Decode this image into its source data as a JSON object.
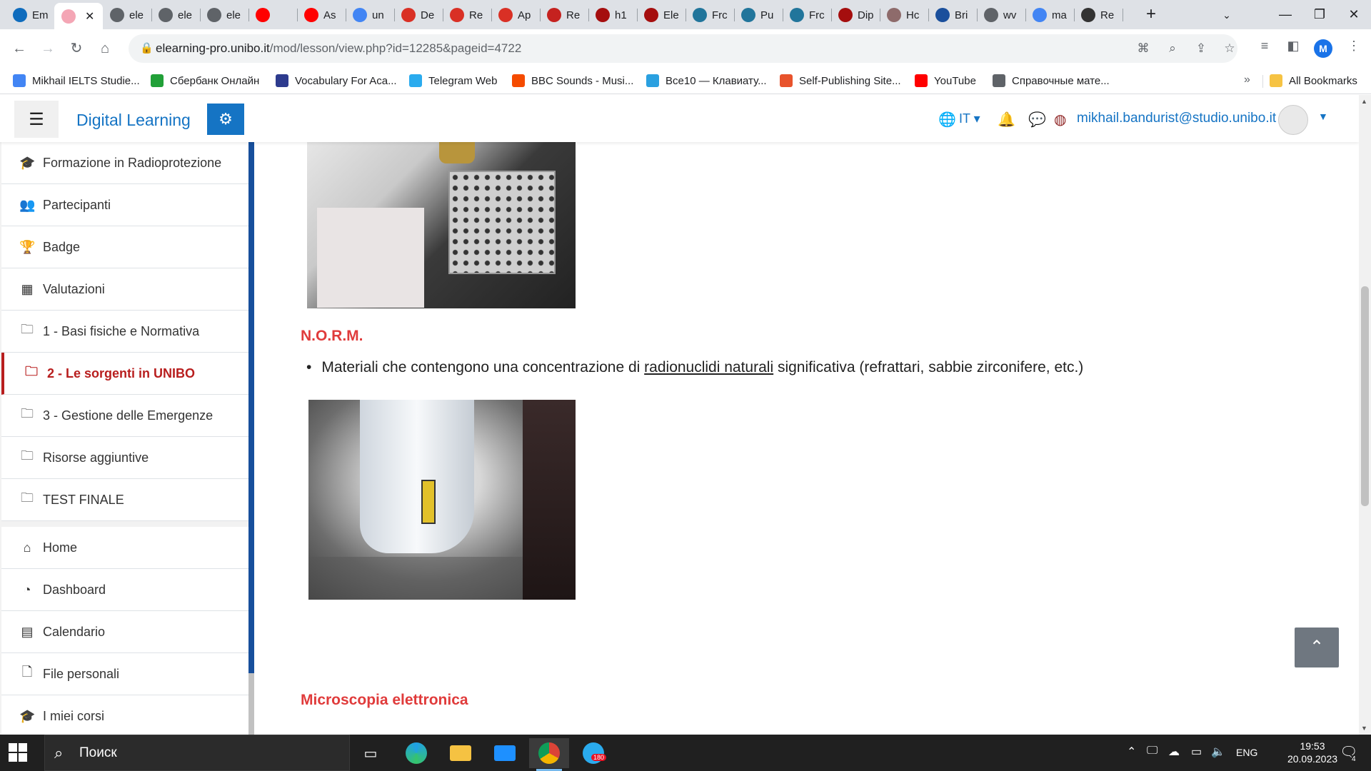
{
  "browser": {
    "tabs": [
      {
        "title": "Em",
        "fav_color": "#0f6cbd"
      },
      {
        "title": "",
        "fav_color": "#f4a6b5",
        "active": true
      },
      {
        "title": "ele",
        "fav_color": "#5f6368"
      },
      {
        "title": "ele",
        "fav_color": "#5f6368"
      },
      {
        "title": "ele",
        "fav_color": "#5f6368"
      },
      {
        "title": "",
        "fav_color": "#ff0000"
      },
      {
        "title": "As",
        "fav_color": "#ff0000"
      },
      {
        "title": "un",
        "fav_color": "#4285f4"
      },
      {
        "title": "De",
        "fav_color": "#d93025"
      },
      {
        "title": "Re",
        "fav_color": "#d93025"
      },
      {
        "title": "Ap",
        "fav_color": "#d93025"
      },
      {
        "title": "Re",
        "fav_color": "#c5221f"
      },
      {
        "title": "h1",
        "fav_color": "#a50e0e"
      },
      {
        "title": "Ele",
        "fav_color": "#a50e0e"
      },
      {
        "title": "Frc",
        "fav_color": "#21759b"
      },
      {
        "title": "Pu",
        "fav_color": "#21759b"
      },
      {
        "title": "Frc",
        "fav_color": "#21759b"
      },
      {
        "title": "Dip",
        "fav_color": "#a50e0e"
      },
      {
        "title": "Hc",
        "fav_color": "#8e6b6b"
      },
      {
        "title": "Bri",
        "fav_color": "#1a4f9c"
      },
      {
        "title": "wv",
        "fav_color": "#5f6368"
      },
      {
        "title": "ma",
        "fav_color": "#4285f4"
      },
      {
        "title": "Re",
        "fav_color": "#333333"
      }
    ],
    "close_glyph": "✕",
    "url_host": "elearning-pro.unibo.it",
    "url_path": "/mod/lesson/view.php?id=12285&pageid=4722",
    "profile_initial": "M",
    "bookmarks": [
      {
        "label": "Mikhail IELTS Studie...",
        "color": "#4285f4"
      },
      {
        "label": "Сбербанк Онлайн",
        "color": "#21a038"
      },
      {
        "label": "Vocabulary For Aca...",
        "color": "#2d3b8e"
      },
      {
        "label": "Telegram Web",
        "color": "#2aabee"
      },
      {
        "label": "BBC Sounds - Musi...",
        "color": "#f54b00"
      },
      {
        "label": "Все10 — Клавиату...",
        "color": "#2aa0e0"
      },
      {
        "label": "Self-Publishing Site...",
        "color": "#e8532c"
      },
      {
        "label": "YouTube",
        "color": "#ff0000"
      },
      {
        "label": "Справочные мате...",
        "color": "#5f6368"
      }
    ],
    "all_bookmarks_label": "All Bookmarks"
  },
  "moodle": {
    "site_name": "Digital Learning",
    "lang": "IT",
    "user_email": "mikhail.bandurist@studio.unibo.it",
    "sidebar_course": [
      {
        "label": "Formazione in Radioprotezione",
        "icon": "graduation-cap-icon",
        "glyph": "🎓"
      },
      {
        "label": "Partecipanti",
        "icon": "users-icon",
        "glyph": "👥"
      },
      {
        "label": "Badge",
        "icon": "trophy-icon",
        "glyph": "🏆"
      },
      {
        "label": "Valutazioni",
        "icon": "table-icon",
        "glyph": "▦"
      },
      {
        "label": "1 - Basi fisiche e Normativa",
        "icon": "folder-icon",
        "glyph": "🗀"
      },
      {
        "label": "2 - Le sorgenti in UNIBO",
        "icon": "folder-icon",
        "glyph": "🗀",
        "active": true
      },
      {
        "label": "3 - Gestione delle Emergenze",
        "icon": "folder-icon",
        "glyph": "🗀"
      },
      {
        "label": "Risorse aggiuntive",
        "icon": "folder-icon",
        "glyph": "🗀"
      },
      {
        "label": "TEST FINALE",
        "icon": "folder-icon",
        "glyph": "🗀"
      }
    ],
    "sidebar_site": [
      {
        "label": "Home",
        "icon": "home-icon",
        "glyph": "⌂"
      },
      {
        "label": "Dashboard",
        "icon": "dashboard-icon",
        "glyph": "◔"
      },
      {
        "label": "Calendario",
        "icon": "calendar-icon",
        "glyph": "▤"
      },
      {
        "label": "File personali",
        "icon": "file-icon",
        "glyph": "🗋"
      },
      {
        "label": "I miei corsi",
        "icon": "graduation-cap-icon",
        "glyph": "🎓"
      }
    ],
    "content": {
      "heading_norm": "N.O.R.M.",
      "bullet_before": "Materiali che contengono una concentrazione di ",
      "bullet_link": "radionuclidi naturali",
      "bullet_after": " significativa (refrattari, sabbie zirconifere, etc.)",
      "heading_micro": "Microscopia elettronica"
    },
    "accent_color": "#1574c4",
    "heading_color": "#e03b3b",
    "active_color": "#b81e1e"
  },
  "taskbar": {
    "search_placeholder": "Поиск",
    "language": "ENG",
    "time": "19:53",
    "date": "20.09.2023",
    "telegram_badge": "180",
    "notification_count": "4"
  }
}
